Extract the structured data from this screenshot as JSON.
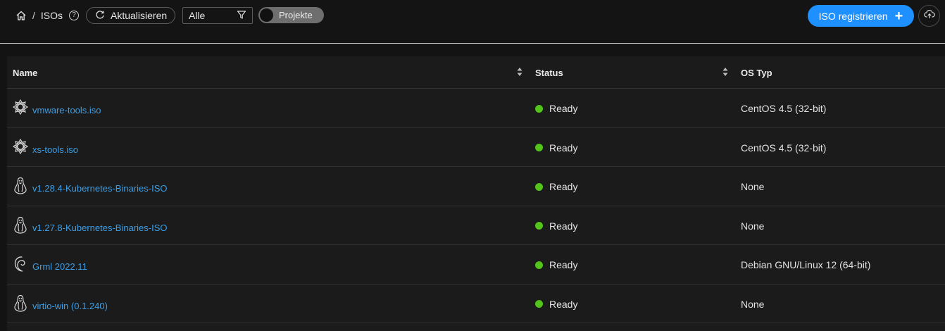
{
  "breadcrumb": {
    "separator": "/",
    "current": "ISOs",
    "help": "?"
  },
  "toolbar": {
    "refresh_label": "Aktualisieren",
    "filter_value": "Alle",
    "toggle_label": "Projekte",
    "register_label": "ISO registrieren",
    "register_plus": "+"
  },
  "table": {
    "columns": {
      "name": "Name",
      "status": "Status",
      "ostype": "OS Typ"
    },
    "rows": [
      {
        "name": "vmware-tools.iso",
        "icon": "centos-icon",
        "status": "Ready",
        "ostype": "CentOS 4.5 (32-bit)"
      },
      {
        "name": "xs-tools.iso",
        "icon": "centos-icon",
        "status": "Ready",
        "ostype": "CentOS 4.5 (32-bit)"
      },
      {
        "name": "v1.28.4-Kubernetes-Binaries-ISO",
        "icon": "linux-tux-icon",
        "status": "Ready",
        "ostype": "None"
      },
      {
        "name": "v1.27.8-Kubernetes-Binaries-ISO",
        "icon": "linux-tux-icon",
        "status": "Ready",
        "ostype": "None"
      },
      {
        "name": "Grml 2022.11",
        "icon": "debian-swirl-icon",
        "status": "Ready",
        "ostype": "Debian GNU/Linux 12 (64-bit)"
      },
      {
        "name": "virtio-win (0.1.240)",
        "icon": "linux-tux-icon",
        "status": "Ready",
        "ostype": "None"
      }
    ]
  },
  "colors": {
    "accent": "#1e90ff",
    "link": "#3d9ee6",
    "status_ready": "#52c41a",
    "background": "#131313"
  }
}
